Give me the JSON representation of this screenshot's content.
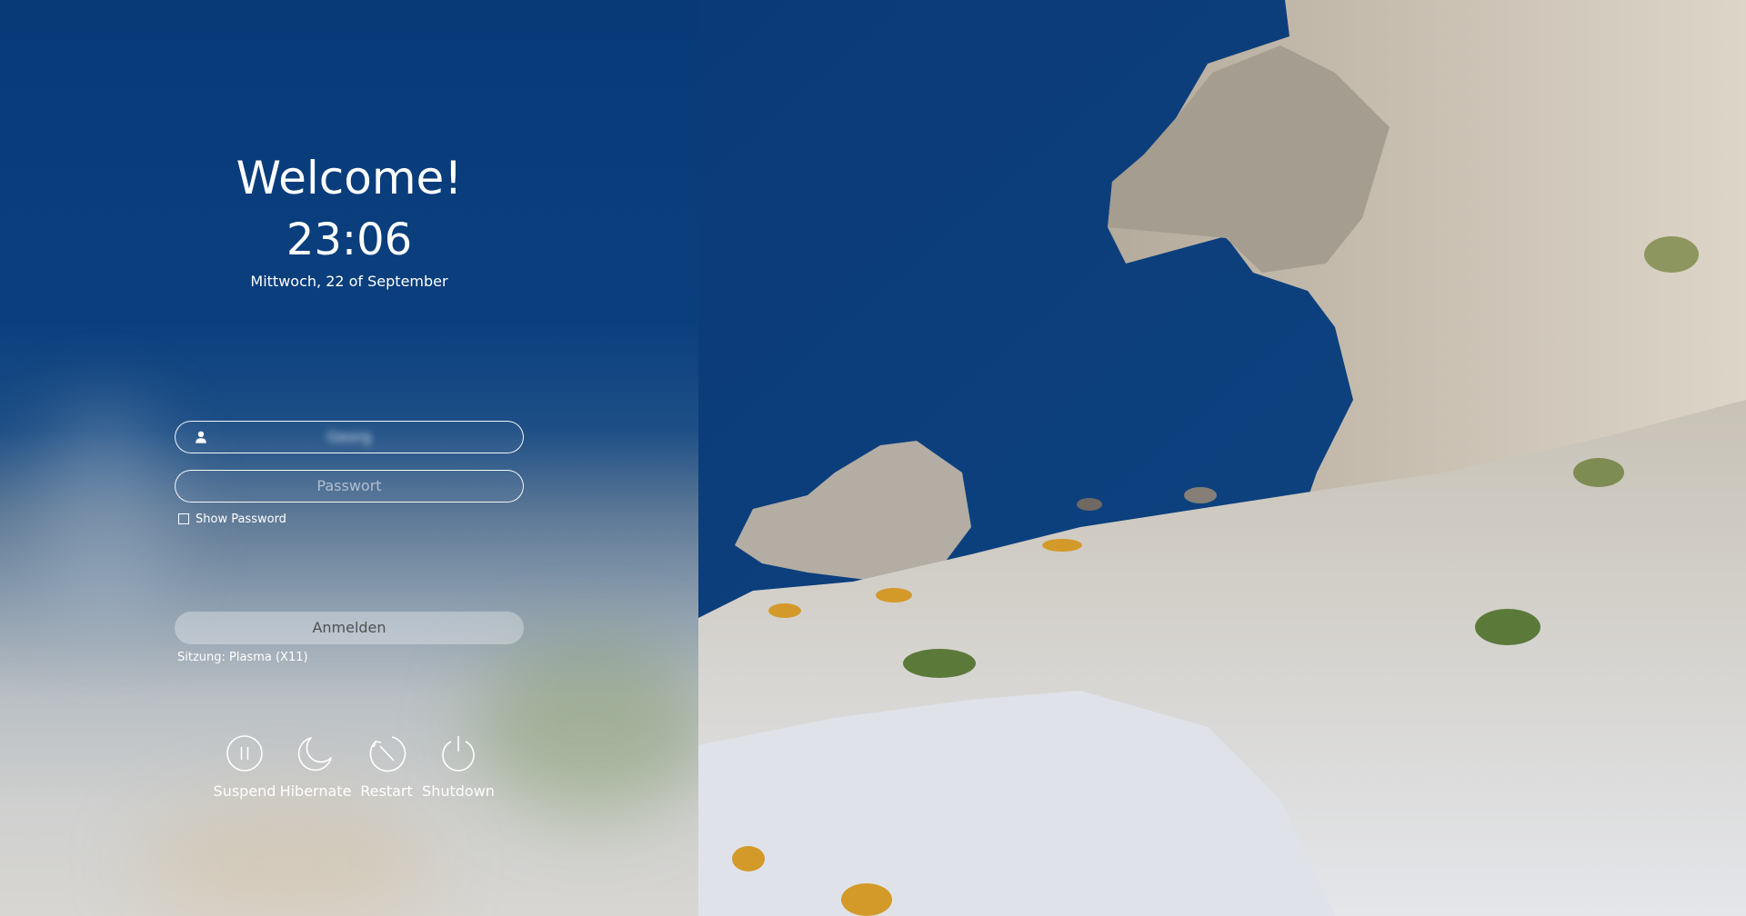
{
  "greeting": {
    "welcome": "Welcome!",
    "time": "23:06",
    "date": "Mittwoch, 22 of September"
  },
  "login": {
    "username_icon": "user-icon",
    "username_value": "Georg",
    "password_placeholder": "Passwort",
    "show_password_label": "Show Password",
    "show_password_checked": false,
    "login_button": "Anmelden",
    "session": "Sitzung: Plasma (X11)"
  },
  "power": {
    "suspend": "Suspend",
    "hibernate": "Hibernate",
    "restart": "Restart",
    "shutdown": "Shutdown"
  },
  "colors": {
    "panel_top": "#083a78",
    "sea": "#0d3f7c",
    "text": "#ffffff"
  }
}
